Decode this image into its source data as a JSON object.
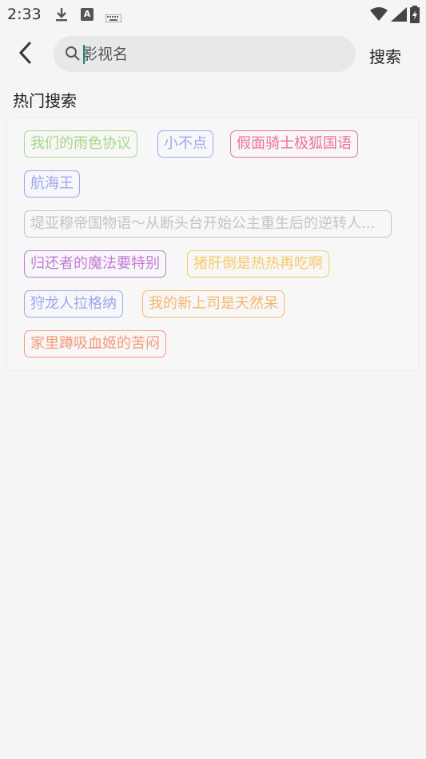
{
  "status_bar": {
    "time": "2:33",
    "icons": [
      "download-icon",
      "a-icon",
      "keyboard-icon",
      "wifi-icon",
      "signal-icon",
      "battery-icon"
    ]
  },
  "search": {
    "placeholder": "影视名",
    "button_label": "搜索"
  },
  "hot_search": {
    "title": "热门搜索",
    "tags": [
      {
        "label": "我们的雨色协议",
        "color": "#a8d88a"
      },
      {
        "label": "小不点",
        "color": "#9aa8f0"
      },
      {
        "label": "假面骑士极狐国语",
        "color": "#ef6f9a"
      },
      {
        "label": "航海王",
        "color": "#9aa8f0"
      },
      {
        "label": "堤亚穆帝国物语～从断头台开始公主重生后的逆转人...",
        "color": "#c4c4c4"
      },
      {
        "label": "归还者的魔法要特别",
        "color": "#c47ad8"
      },
      {
        "label": "猪肝倒是热热再吃啊",
        "color": "#f5cc6a"
      },
      {
        "label": "狩龙人拉格纳",
        "color": "#9aa8f0"
      },
      {
        "label": "我的新上司是天然呆",
        "color": "#f5b86a"
      },
      {
        "label": "家里蹲吸血姬的苦闷",
        "color": "#f59a7a"
      }
    ]
  }
}
